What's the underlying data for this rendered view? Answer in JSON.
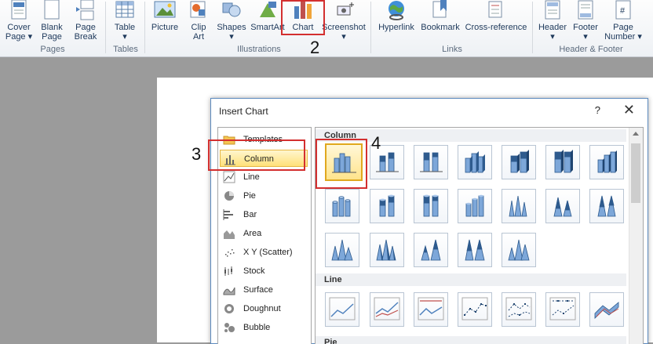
{
  "ribbon": {
    "buttons": [
      {
        "label": "Cover\nPage ▾",
        "name": "cover-page-button"
      },
      {
        "label": "Blank\nPage",
        "name": "blank-page-button"
      },
      {
        "label": "Page\nBreak",
        "name": "page-break-button"
      },
      {
        "label": "Table\n▾",
        "name": "table-button"
      },
      {
        "label": "Picture",
        "name": "picture-button"
      },
      {
        "label": "Clip\nArt",
        "name": "clip-art-button"
      },
      {
        "label": "Shapes\n▾",
        "name": "shapes-button"
      },
      {
        "label": "SmartArt",
        "name": "smartart-button"
      },
      {
        "label": "Chart",
        "name": "chart-button"
      },
      {
        "label": "Screenshot\n▾",
        "name": "screenshot-button"
      },
      {
        "label": "Hyperlink",
        "name": "hyperlink-button"
      },
      {
        "label": "Bookmark",
        "name": "bookmark-button"
      },
      {
        "label": "Cross-reference",
        "name": "cross-reference-button"
      },
      {
        "label": "Header\n▾",
        "name": "header-button"
      },
      {
        "label": "Footer\n▾",
        "name": "footer-button"
      },
      {
        "label": "Page\nNumber ▾",
        "name": "page-number-button"
      }
    ],
    "groups": {
      "pages": "Pages",
      "tables": "Tables",
      "illustrations": "Illustrations",
      "links": "Links",
      "header_footer": "Header & Footer"
    }
  },
  "callouts": {
    "n2": "2",
    "n3": "3",
    "n4": "4"
  },
  "dialog": {
    "title": "Insert Chart",
    "help": "?",
    "close": "✕",
    "chart_types": [
      "Templates",
      "Column",
      "Line",
      "Pie",
      "Bar",
      "Area",
      "X Y (Scatter)",
      "Stock",
      "Surface",
      "Doughnut",
      "Bubble"
    ],
    "selected_type": "Column",
    "sections": {
      "column": "Column",
      "line": "Line",
      "pie": "Pie"
    }
  },
  "colors": {
    "accent": "#d32f2f",
    "selection": "#ffe17a",
    "bar_blue": "#4f81bd"
  }
}
